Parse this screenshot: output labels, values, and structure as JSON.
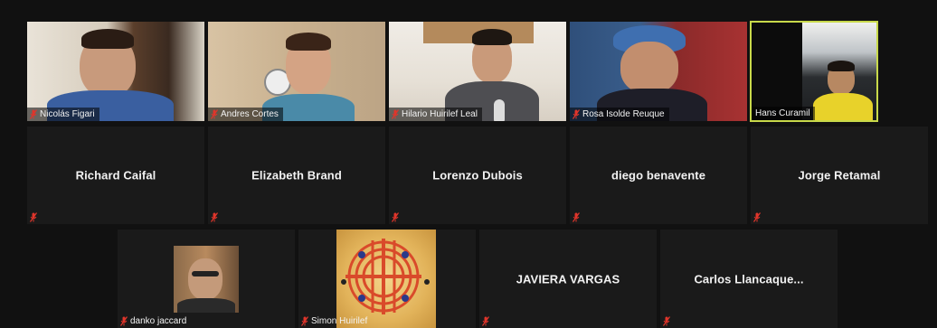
{
  "meeting": {
    "participants": [
      {
        "name": "Nicolás Figari",
        "muted": true,
        "video": true
      },
      {
        "name": "Andres Cortes",
        "muted": true,
        "video": true
      },
      {
        "name": "Hilario Huirilef Leal",
        "muted": true,
        "video": true
      },
      {
        "name": "Rosa Isolde Reuque",
        "muted": true,
        "video": true
      },
      {
        "name": "Hans Curamil",
        "muted": false,
        "video": true,
        "active_speaker": true
      },
      {
        "name": "Richard Caifal",
        "muted": true,
        "video": false
      },
      {
        "name": "Elizabeth Brand",
        "muted": true,
        "video": false
      },
      {
        "name": "Lorenzo Dubois",
        "muted": true,
        "video": false
      },
      {
        "name": "diego benavente",
        "muted": true,
        "video": false
      },
      {
        "name": "Jorge Retamal",
        "muted": true,
        "video": false
      },
      {
        "name": "danko jaccard",
        "muted": true,
        "video": true
      },
      {
        "name": "Simon Huirilef",
        "muted": true,
        "video": true
      },
      {
        "name": "JAVIERA VARGAS",
        "muted": true,
        "video": false
      },
      {
        "name": "Carlos  Llancaque...",
        "muted": true,
        "video": false
      }
    ]
  },
  "colors": {
    "active_border": "#c8d94a",
    "mute_icon": "#e0352b",
    "tile_bg": "#1a1a1a"
  },
  "icons": {
    "muted": "muted-mic-icon"
  }
}
